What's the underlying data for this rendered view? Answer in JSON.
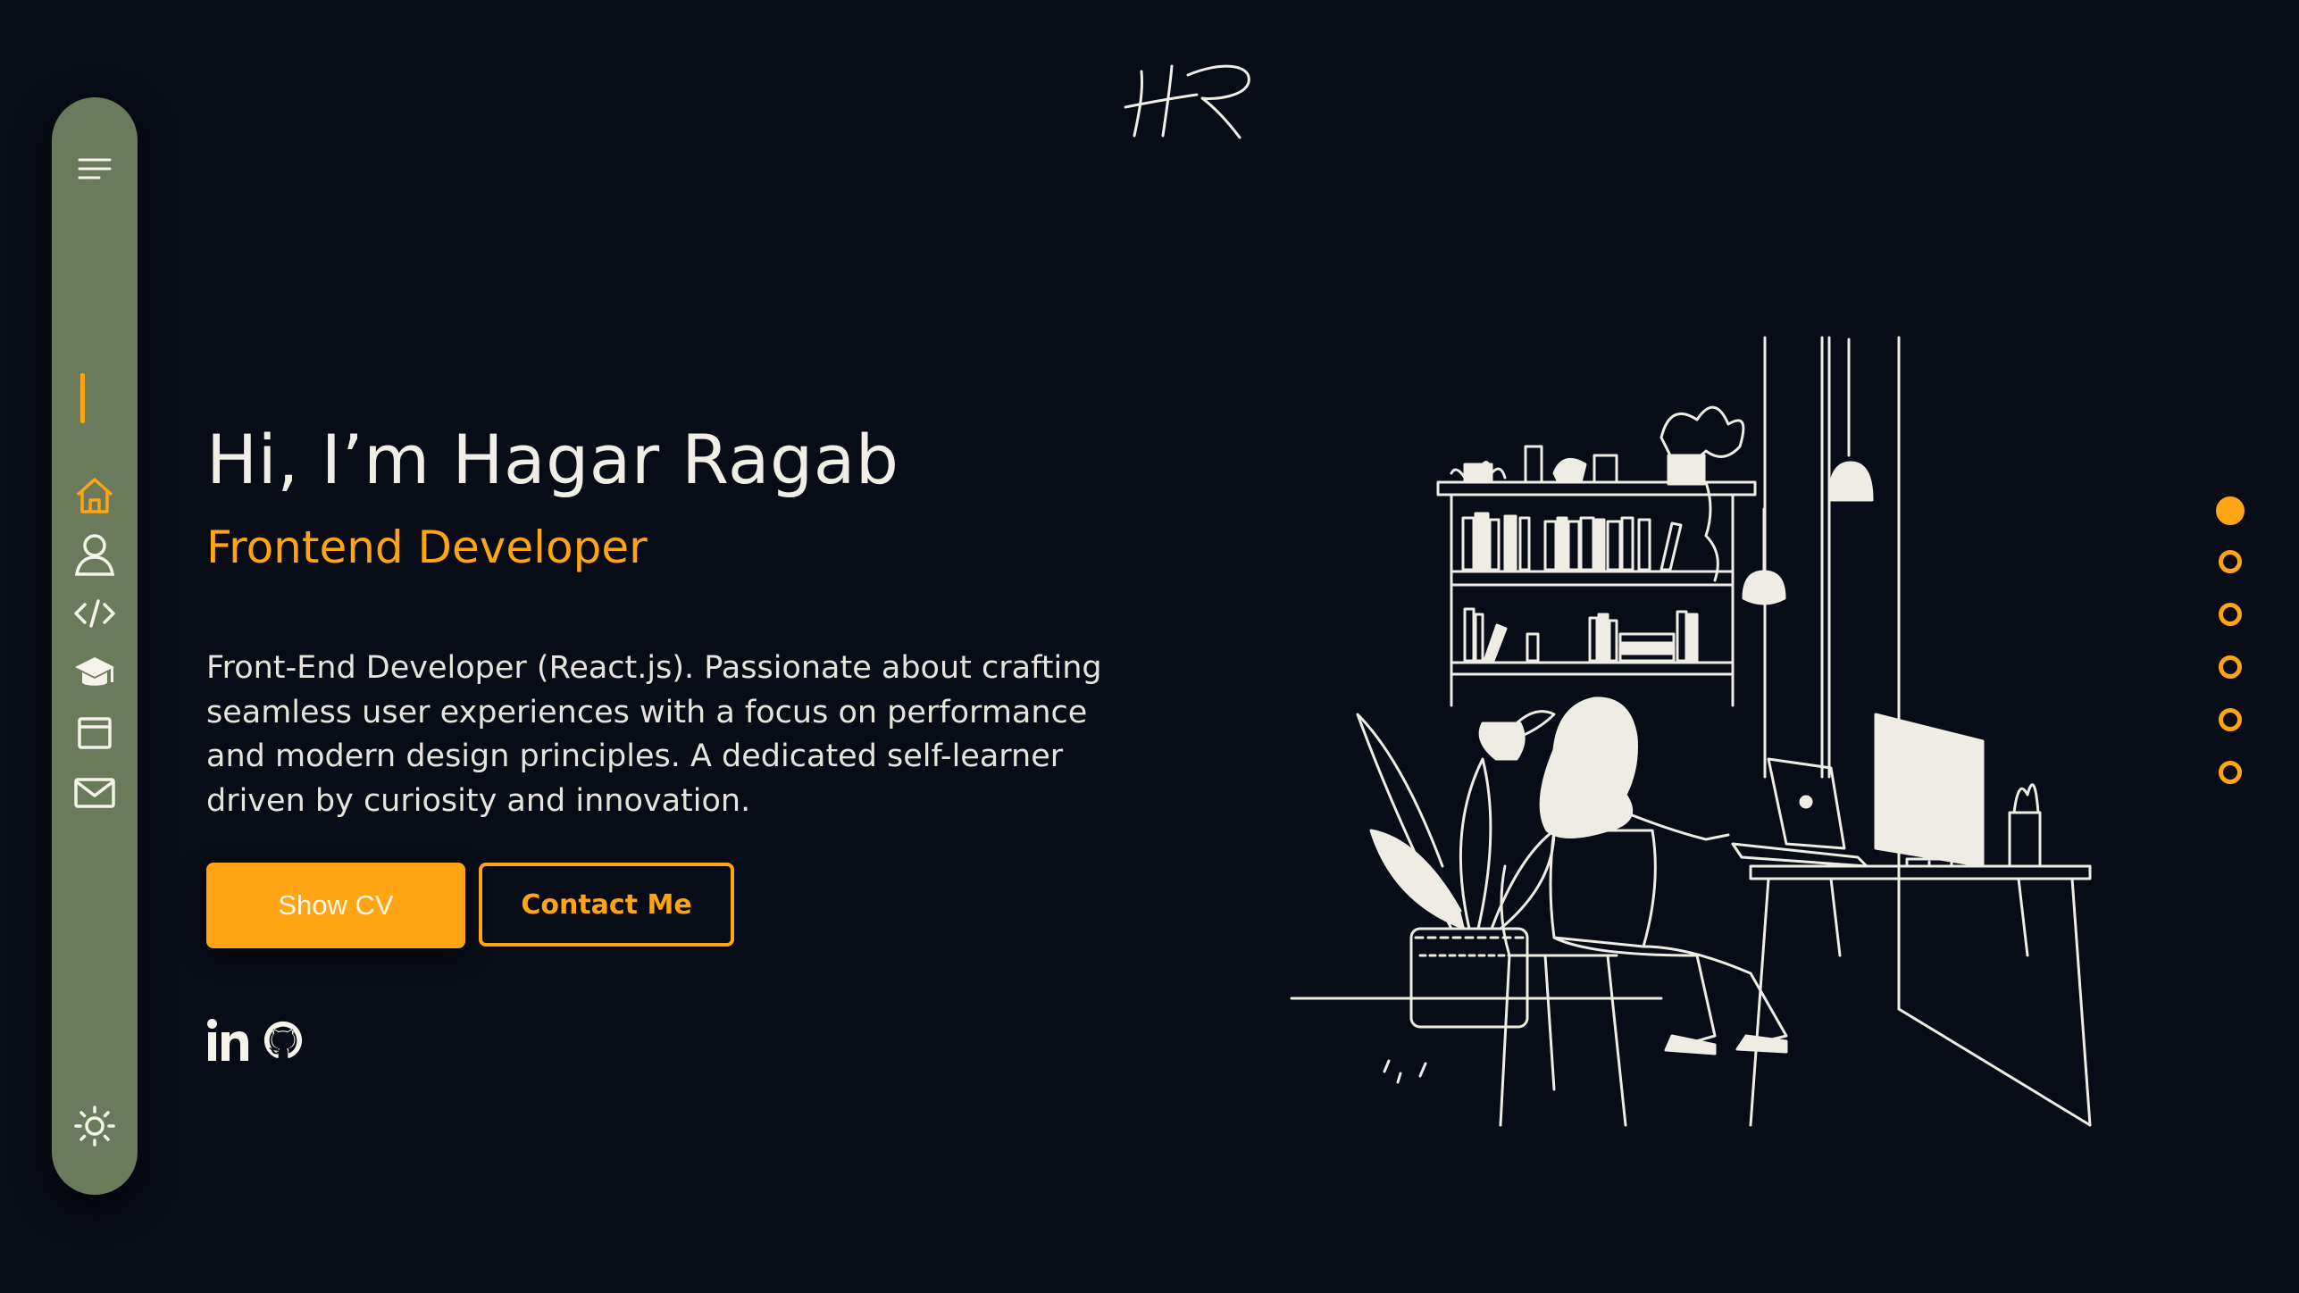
{
  "logo": {
    "icon": "hr-signature-logo"
  },
  "sidebar": {
    "items": [
      {
        "icon": "menu-icon",
        "name": "menu"
      },
      {
        "icon": "home-icon",
        "name": "home"
      },
      {
        "icon": "user-icon",
        "name": "about"
      },
      {
        "icon": "code-icon",
        "name": "skills"
      },
      {
        "icon": "graduation-cap-icon",
        "name": "education"
      },
      {
        "icon": "browser-window-icon",
        "name": "projects"
      },
      {
        "icon": "mail-icon",
        "name": "contact"
      },
      {
        "icon": "sun-icon",
        "name": "theme-toggle"
      }
    ],
    "active": "home"
  },
  "hero": {
    "title": "Hi, I’m Hagar Ragab",
    "subtitle": "Frontend Developer",
    "description": "Front-End Developer (React.js). Passionate about crafting seamless user experiences with a focus on performance and modern design principles. A dedicated self-learner driven by curiosity and innovation.",
    "show_cv_label": "Show CV",
    "contact_label": "Contact Me"
  },
  "social": [
    {
      "icon": "linkedin-icon"
    },
    {
      "icon": "github-icon"
    }
  ],
  "pagination": {
    "count": 6,
    "active_index": 0
  },
  "colors": {
    "background": "#080c17",
    "accent": "#ffa514",
    "sidebar": "#6b7a5a",
    "text": "#eeece4"
  }
}
